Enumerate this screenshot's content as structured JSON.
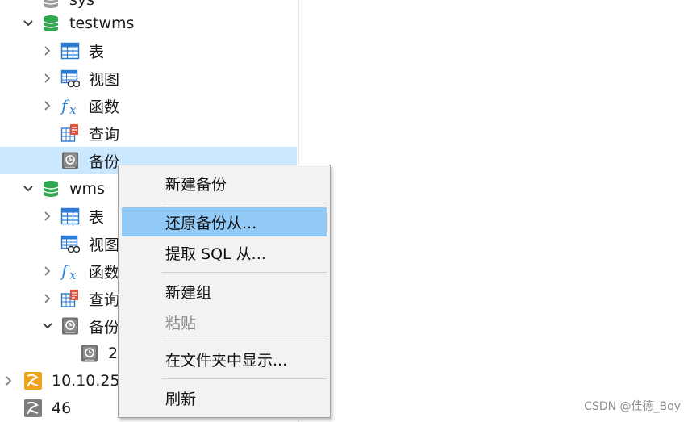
{
  "tree": {
    "items": [
      {
        "label": "sys",
        "icon": "database-gray-icon"
      },
      {
        "label": "testwms",
        "icon": "database-green-icon"
      },
      {
        "label": "表",
        "icon": "table-icon"
      },
      {
        "label": "视图",
        "icon": "view-icon"
      },
      {
        "label": "函数",
        "icon": "function-icon"
      },
      {
        "label": "查询",
        "icon": "query-icon"
      },
      {
        "label": "备份",
        "icon": "backup-icon"
      },
      {
        "label": "wms",
        "icon": "database-green-icon"
      },
      {
        "label": "表",
        "icon": "table-icon"
      },
      {
        "label": "视图",
        "icon": "view-icon"
      },
      {
        "label": "函数",
        "icon": "function-icon"
      },
      {
        "label": "查询",
        "icon": "query-icon"
      },
      {
        "label": "备份",
        "icon": "backup-icon"
      },
      {
        "label": "2",
        "icon": "backup-file-icon"
      },
      {
        "label": "10.10.25",
        "icon": "connection-orange-icon"
      },
      {
        "label": "46",
        "icon": "connection-gray-icon"
      }
    ]
  },
  "context_menu": {
    "items": [
      {
        "label": "新建备份",
        "state": "normal"
      },
      {
        "label": "还原备份从...",
        "state": "highlighted"
      },
      {
        "label": "提取 SQL 从...",
        "state": "normal"
      },
      {
        "label": "新建组",
        "state": "normal"
      },
      {
        "label": "粘贴",
        "state": "disabled"
      },
      {
        "label": "在文件夹中显示...",
        "state": "normal"
      },
      {
        "label": "刷新",
        "state": "normal"
      }
    ]
  },
  "colors": {
    "selection": "#cce8ff",
    "menu_highlight": "#91c9f7",
    "database_green": "#2fa84f",
    "connection_orange": "#f0a21c"
  },
  "watermark": "CSDN @佳德_Boy"
}
